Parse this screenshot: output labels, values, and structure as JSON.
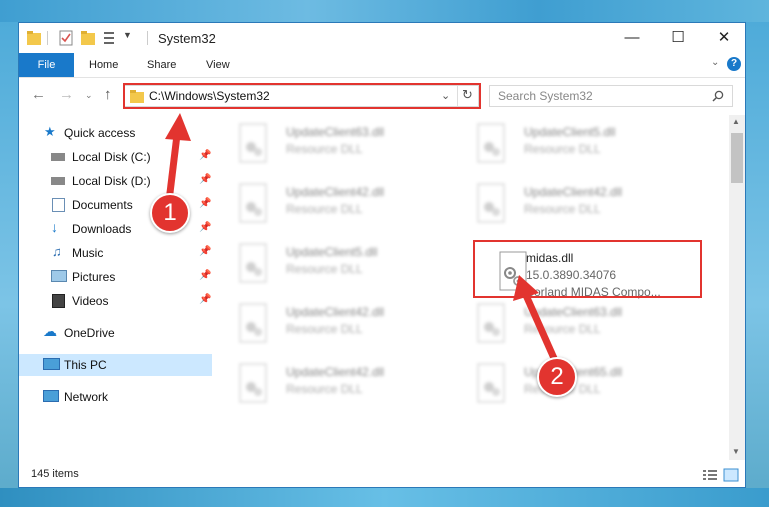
{
  "window": {
    "title": "System32"
  },
  "ribbon": {
    "tabs": [
      "File",
      "Home",
      "Share",
      "View"
    ]
  },
  "address": {
    "path": "C:\\Windows\\System32"
  },
  "search": {
    "placeholder": "Search System32"
  },
  "sidebar": {
    "quick_access": "Quick access",
    "items": [
      "Local Disk (C:)",
      "Local Disk (D:)",
      "Documents",
      "Downloads",
      "Music",
      "Pictures",
      "Videos"
    ],
    "onedrive": "OneDrive",
    "this_pc": "This PC",
    "network": "Network"
  },
  "files": [
    {
      "name": "UpdateClient63.dll",
      "type": "Resource DLL"
    },
    {
      "name": "UpdateClient5.dll",
      "type": "Resource DLL"
    },
    {
      "name": "UpdateClient42.dll",
      "type": "Resource DLL"
    },
    {
      "name": "UpdateClient42.dll",
      "type": "Resource DLL"
    },
    {
      "name": "UpdateClient5.dll",
      "type": "Resource DLL"
    },
    {
      "name": "UpdateClient42.dll",
      "type": "Resource DLL"
    },
    {
      "name": "UpdateClient63.dll",
      "type": "Resource DLL"
    },
    {
      "name": "UpdateClient42.dll",
      "type": "Resource DLL"
    },
    {
      "name": "UpdateClient65.dll",
      "type": "Resource DLL"
    }
  ],
  "highlighted_file": {
    "name": "midas.dll",
    "version": "15.0.3890.34076",
    "description": "Borland MIDAS Compo..."
  },
  "status": {
    "items": "145 items"
  },
  "annotations": {
    "step1": "1",
    "step2": "2"
  },
  "colors": {
    "accent": "#1979ca",
    "annotation": "#e2342f",
    "selection": "#cce8ff"
  }
}
